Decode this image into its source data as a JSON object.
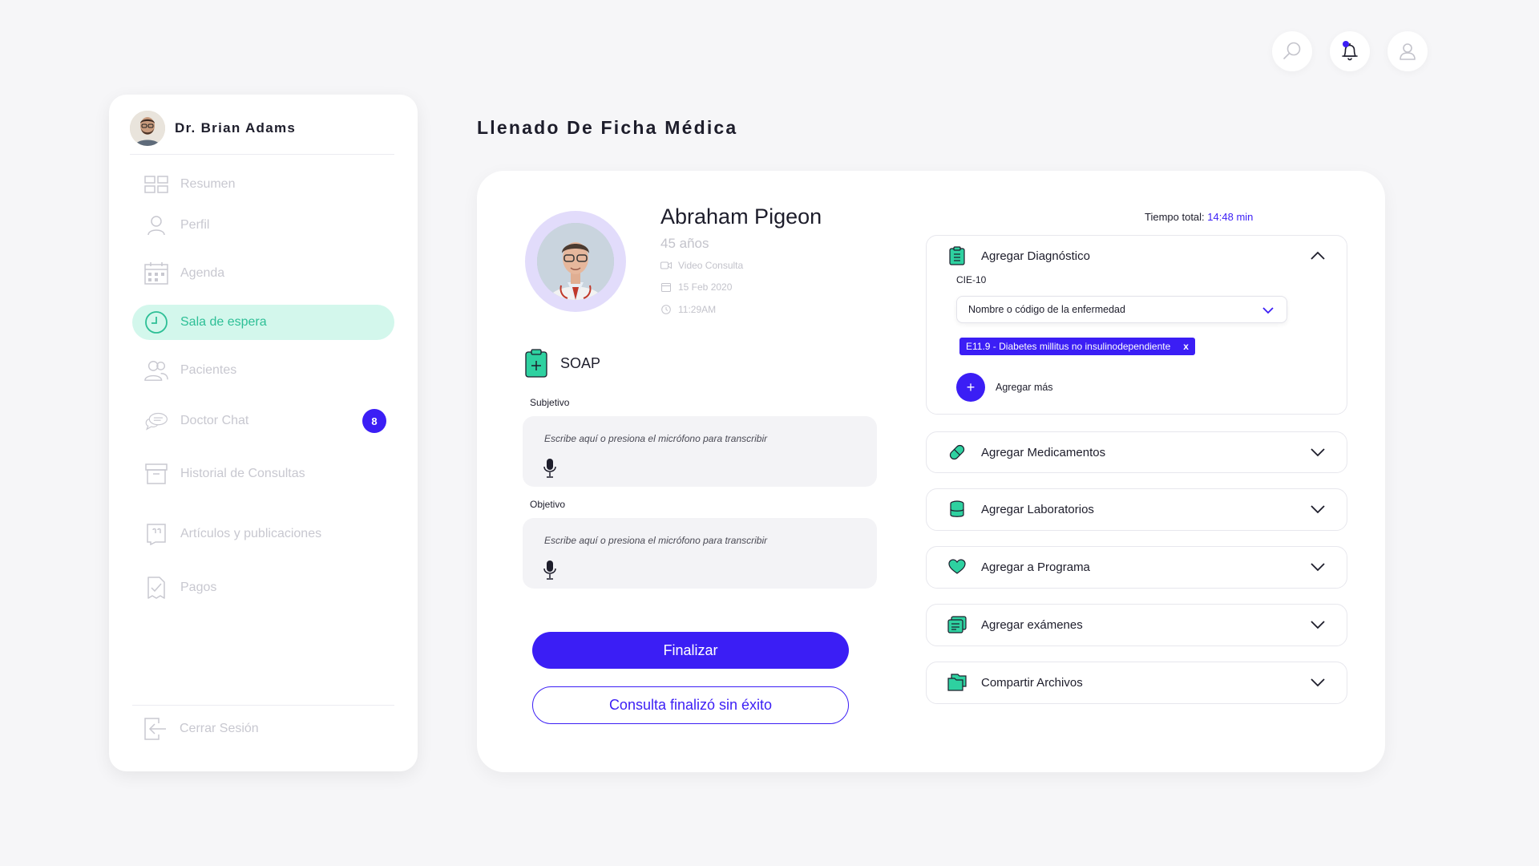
{
  "doctor": {
    "name": "Dr. Brian Adams"
  },
  "nav": {
    "items": [
      {
        "label": "Resumen",
        "icon": "dashboard-icon"
      },
      {
        "label": "Perfil",
        "icon": "user-icon"
      },
      {
        "label": "Agenda",
        "icon": "calendar-icon"
      },
      {
        "label": "Sala de espera",
        "icon": "clock-icon",
        "active": true
      },
      {
        "label": "Pacientes",
        "icon": "users-icon"
      },
      {
        "label": "Doctor Chat",
        "icon": "chat-icon",
        "badge": "8"
      },
      {
        "label": "Historial de Consultas",
        "icon": "archive-icon"
      },
      {
        "label": "Artículos y publicaciones",
        "icon": "article-icon"
      },
      {
        "label": "Pagos",
        "icon": "payment-icon"
      }
    ],
    "logout_label": "Cerrar Sesión"
  },
  "page": {
    "title": "Llenado De Ficha Médica"
  },
  "patient": {
    "name": "Abraham Pigeon",
    "age": "45 años",
    "consult_type": "Video Consulta",
    "date": "15 Feb 2020",
    "time": "11:29AM"
  },
  "soap": {
    "title": "SOAP",
    "subjective_label": "Subjetivo",
    "objective_label": "Objetivo",
    "placeholder": "Escribe aquí o presiona el micrófono para transcribir"
  },
  "actions": {
    "finalize_label": "Finalizar",
    "failed_label": "Consulta finalizó sin éxito"
  },
  "timer": {
    "label": "Tiempo total:",
    "value": "14:48 min"
  },
  "diagnosis": {
    "title": "Agregar Diagnóstico",
    "code_label": "CIE-10",
    "select_placeholder": "Nombre o código de la enfermedad",
    "chip": "E11.9 - Diabetes millitus no insulinodependiente",
    "chip_remove": "x",
    "add_more": "Agregar más"
  },
  "sections": [
    {
      "label": "Agregar Medicamentos",
      "icon": "pill-icon"
    },
    {
      "label": "Agregar Laboratorios",
      "icon": "lab-icon"
    },
    {
      "label": "Agregar a Programa",
      "icon": "heart-icon"
    },
    {
      "label": "Agregar exámenes",
      "icon": "exams-icon"
    },
    {
      "label": "Compartir Archivos",
      "icon": "files-icon"
    }
  ],
  "colors": {
    "accent": "#3b1ef5",
    "green": "#2dbf96",
    "active_bg": "#d3f7ec"
  }
}
